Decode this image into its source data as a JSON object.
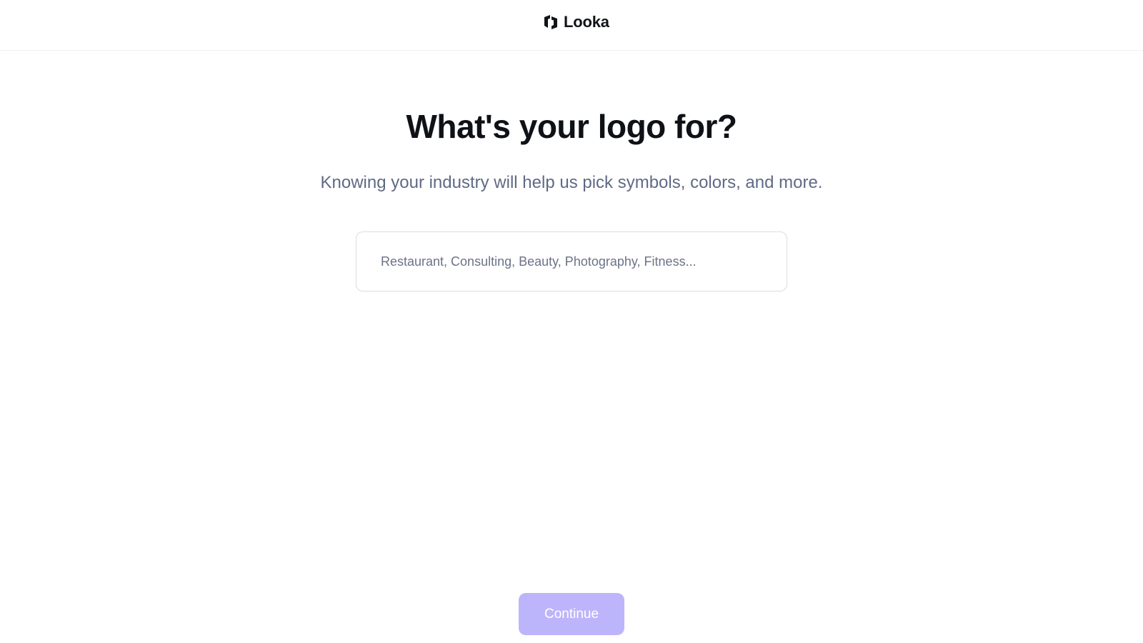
{
  "header": {
    "brand_name": "Looka",
    "brand_icon": "looka-logo-icon"
  },
  "main": {
    "title": "What's your logo for?",
    "subtitle": "Knowing your industry will help us pick symbols, colors, and more.",
    "industry_input": {
      "value": "",
      "placeholder": "Restaurant, Consulting, Beauty, Photography, Fitness..."
    }
  },
  "footer": {
    "continue_label": "Continue"
  },
  "colors": {
    "accent_disabled": "#bdb5fb",
    "title": "#0e1116",
    "subtitle": "#5f6a84",
    "input_border": "#d9dde4"
  }
}
